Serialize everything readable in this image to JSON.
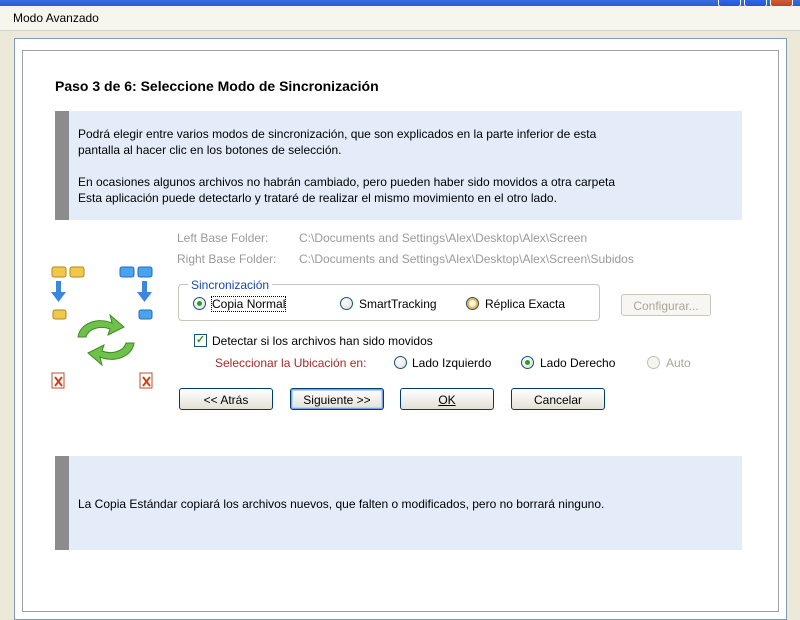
{
  "window": {
    "menu_title": "Modo Avanzado"
  },
  "page": {
    "title": "Paso 3 de 6: Seleccione Modo de Sincronización"
  },
  "info": {
    "line1": "Podrá elegir entre varios modos de sincronización, que son explicados en la parte inferior de esta",
    "line2": "pantalla al hacer clic en los botones de selección.",
    "line3": "En ocasiones algunos archivos no habrán cambiado, pero pueden haber sido movidos a otra carpeta",
    "line4": "Esta aplicación puede detectarlo y trataré de realizar el mismo movimiento en el otro lado."
  },
  "folders": {
    "left_label": "Left Base Folder:",
    "left_value": "C:\\Documents and Settings\\Alex\\Desktop\\Alex\\Screen",
    "right_label": "Right Base Folder:",
    "right_value": "C:\\Documents and Settings\\Alex\\Desktop\\Alex\\Screen\\Subidos"
  },
  "sync": {
    "legend": "Sincronización",
    "options": [
      "Copia Normal",
      "SmartTracking",
      "Réplica Exacta"
    ],
    "selected": "Copia Normal",
    "configure_label": "Configurar..."
  },
  "detect": {
    "checkbox_label": "Detectar si los archivos han sido movidos",
    "checked": true,
    "location_label": "Seleccionar la Ubicación en:",
    "location_options": [
      "Lado Izquierdo",
      "Lado Derecho",
      "Auto"
    ],
    "location_selected": "Lado Derecho"
  },
  "buttons": {
    "back": "<< Atrás",
    "next": "Siguiente >>",
    "ok": "OK",
    "cancel": "Cancelar"
  },
  "description": "La Copia Estándar copiará los archivos nuevos, que falten o modificados, pero no borrará ninguno.",
  "colors": {
    "accent_blue": "#1a46b3",
    "location_red": "#a52a2a",
    "check_green": "#21a121"
  }
}
